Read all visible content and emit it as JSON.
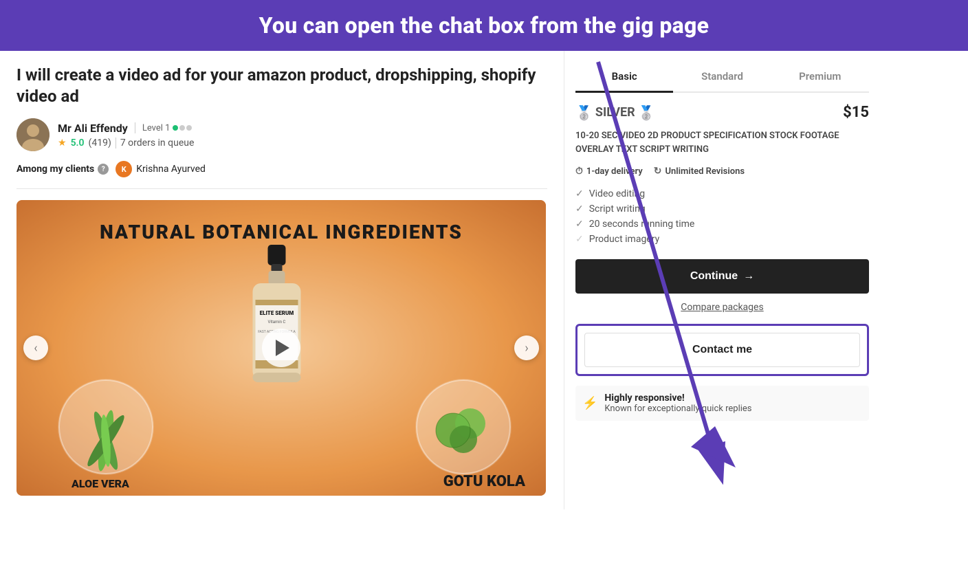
{
  "banner": {
    "text": "You can open the chat box from the gig page"
  },
  "gig": {
    "title": "I will create a video ad for your amazon product, dropshipping, shopify video ad",
    "seller": {
      "name": "Mr Ali Effendy",
      "level": "Level 1",
      "rating": "5.0",
      "reviews": "419",
      "orders": "7 orders in queue"
    },
    "clients_label": "Among my clients",
    "client_name": "Krishna Ayurved",
    "image_title": "NATURAL BOTANICAL INGREDIENTS",
    "plant_left": "ALOE VERA",
    "plant_right": "GOTU KOLA",
    "product_name": "ELITE SERUM",
    "product_sub": "Vitamin C"
  },
  "package": {
    "tabs": [
      "Basic",
      "Standard",
      "Premium"
    ],
    "active_tab": "Basic",
    "tier_name": "SILVER",
    "price": "$15",
    "description": "10-20 SEC VIDEO 2D PRODUCT SPECIFICATION STOCK FOOTAGE OVERLAY TEXT SCRIPT WRITING",
    "delivery": "1-day delivery",
    "revisions": "Unlimited Revisions",
    "features": [
      {
        "label": "Video editing",
        "checked": true
      },
      {
        "label": "Script writing",
        "checked": true
      },
      {
        "label": "20 seconds running time",
        "checked": true
      },
      {
        "label": "Product imagery",
        "checked": false
      }
    ],
    "continue_label": "Continue",
    "compare_label": "Compare packages",
    "contact_label": "Contact me",
    "responsive_title": "Highly responsive!",
    "responsive_sub": "Known for exceptionally quick replies"
  }
}
